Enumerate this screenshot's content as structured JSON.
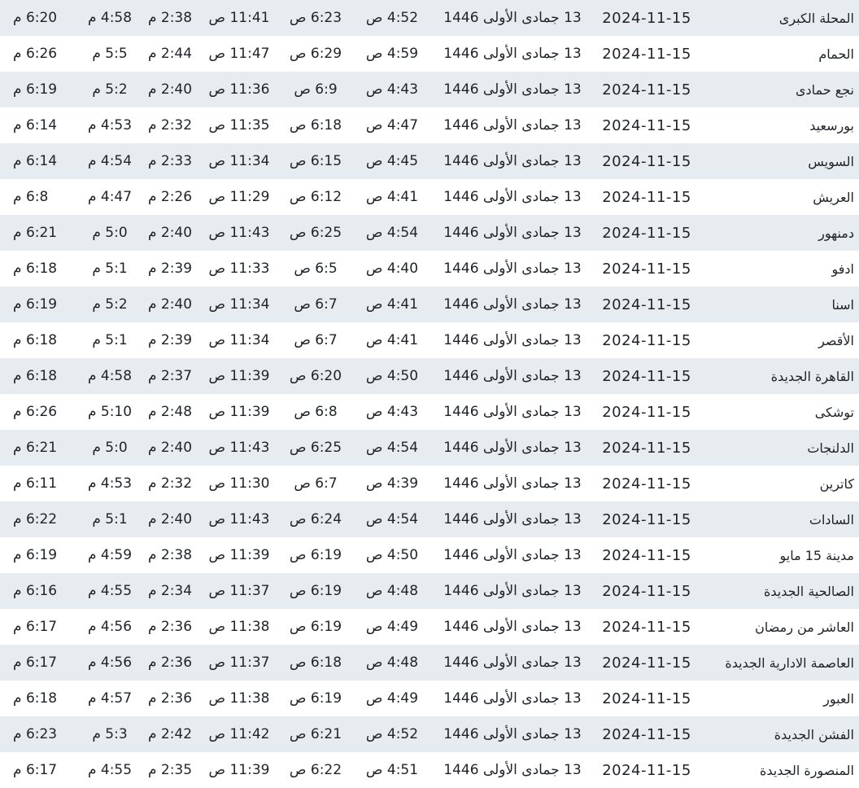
{
  "table": {
    "rows": [
      {
        "city": "المحلة الكبرى",
        "date": "2024-11-15",
        "hijri": "13 جمادى الأولى 1446",
        "fajr": "4:52 ص",
        "sunrise": "6:23 ص",
        "dhuhr": "11:41 ص",
        "asr": "2:38 م",
        "maghrib": "4:58 م",
        "isha": "6:20 م"
      },
      {
        "city": "الحمام",
        "date": "2024-11-15",
        "hijri": "13 جمادى الأولى 1446",
        "fajr": "4:59 ص",
        "sunrise": "6:29 ص",
        "dhuhr": "11:47 ص",
        "asr": "2:44 م",
        "maghrib": "5:5 م",
        "isha": "6:26 م"
      },
      {
        "city": "نجع حمادى",
        "date": "2024-11-15",
        "hijri": "13 جمادى الأولى 1446",
        "fajr": "4:43 ص",
        "sunrise": "6:9 ص",
        "dhuhr": "11:36 ص",
        "asr": "2:40 م",
        "maghrib": "5:2 م",
        "isha": "6:19 م"
      },
      {
        "city": "بورسعيد",
        "date": "2024-11-15",
        "hijri": "13 جمادى الأولى 1446",
        "fajr": "4:47 ص",
        "sunrise": "6:18 ص",
        "dhuhr": "11:35 ص",
        "asr": "2:32 م",
        "maghrib": "4:53 م",
        "isha": "6:14 م"
      },
      {
        "city": "السويس",
        "date": "2024-11-15",
        "hijri": "13 جمادى الأولى 1446",
        "fajr": "4:45 ص",
        "sunrise": "6:15 ص",
        "dhuhr": "11:34 ص",
        "asr": "2:33 م",
        "maghrib": "4:54 م",
        "isha": "6:14 م"
      },
      {
        "city": "العريش",
        "date": "2024-11-15",
        "hijri": "13 جمادى الأولى 1446",
        "fajr": "4:41 ص",
        "sunrise": "6:12 ص",
        "dhuhr": "11:29 ص",
        "asr": "2:26 م",
        "maghrib": "4:47 م",
        "isha": "6:8 م"
      },
      {
        "city": "دمنهور",
        "date": "2024-11-15",
        "hijri": "13 جمادى الأولى 1446",
        "fajr": "4:54 ص",
        "sunrise": "6:25 ص",
        "dhuhr": "11:43 ص",
        "asr": "2:40 م",
        "maghrib": "5:0 م",
        "isha": "6:21 م"
      },
      {
        "city": "ادفو",
        "date": "2024-11-15",
        "hijri": "13 جمادى الأولى 1446",
        "fajr": "4:40 ص",
        "sunrise": "6:5 ص",
        "dhuhr": "11:33 ص",
        "asr": "2:39 م",
        "maghrib": "5:1 م",
        "isha": "6:18 م"
      },
      {
        "city": "اسنا",
        "date": "2024-11-15",
        "hijri": "13 جمادى الأولى 1446",
        "fajr": "4:41 ص",
        "sunrise": "6:7 ص",
        "dhuhr": "11:34 ص",
        "asr": "2:40 م",
        "maghrib": "5:2 م",
        "isha": "6:19 م"
      },
      {
        "city": "الأقصر",
        "date": "2024-11-15",
        "hijri": "13 جمادى الأولى 1446",
        "fajr": "4:41 ص",
        "sunrise": "6:7 ص",
        "dhuhr": "11:34 ص",
        "asr": "2:39 م",
        "maghrib": "5:1 م",
        "isha": "6:18 م"
      },
      {
        "city": "القاهرة الجديدة",
        "date": "2024-11-15",
        "hijri": "13 جمادى الأولى 1446",
        "fajr": "4:50 ص",
        "sunrise": "6:20 ص",
        "dhuhr": "11:39 ص",
        "asr": "2:37 م",
        "maghrib": "4:58 م",
        "isha": "6:18 م"
      },
      {
        "city": "توشكى",
        "date": "2024-11-15",
        "hijri": "13 جمادى الأولى 1446",
        "fajr": "4:43 ص",
        "sunrise": "6:8 ص",
        "dhuhr": "11:39 ص",
        "asr": "2:48 م",
        "maghrib": "5:10 م",
        "isha": "6:26 م"
      },
      {
        "city": "الدلنجات",
        "date": "2024-11-15",
        "hijri": "13 جمادى الأولى 1446",
        "fajr": "4:54 ص",
        "sunrise": "6:25 ص",
        "dhuhr": "11:43 ص",
        "asr": "2:40 م",
        "maghrib": "5:0 م",
        "isha": "6:21 م"
      },
      {
        "city": "كاترين",
        "date": "2024-11-15",
        "hijri": "13 جمادى الأولى 1446",
        "fajr": "4:39 ص",
        "sunrise": "6:7 ص",
        "dhuhr": "11:30 ص",
        "asr": "2:32 م",
        "maghrib": "4:53 م",
        "isha": "6:11 م"
      },
      {
        "city": "السادات",
        "date": "2024-11-15",
        "hijri": "13 جمادى الأولى 1446",
        "fajr": "4:54 ص",
        "sunrise": "6:24 ص",
        "dhuhr": "11:43 ص",
        "asr": "2:40 م",
        "maghrib": "5:1 م",
        "isha": "6:22 م"
      },
      {
        "city": "مدينة 15 مايو",
        "date": "2024-11-15",
        "hijri": "13 جمادى الأولى 1446",
        "fajr": "4:50 ص",
        "sunrise": "6:19 ص",
        "dhuhr": "11:39 ص",
        "asr": "2:38 م",
        "maghrib": "4:59 م",
        "isha": "6:19 م"
      },
      {
        "city": "الصالحية الجديدة",
        "date": "2024-11-15",
        "hijri": "13 جمادى الأولى 1446",
        "fajr": "4:48 ص",
        "sunrise": "6:19 ص",
        "dhuhr": "11:37 ص",
        "asr": "2:34 م",
        "maghrib": "4:55 م",
        "isha": "6:16 م"
      },
      {
        "city": "العاشر من رمضان",
        "date": "2024-11-15",
        "hijri": "13 جمادى الأولى 1446",
        "fajr": "4:49 ص",
        "sunrise": "6:19 ص",
        "dhuhr": "11:38 ص",
        "asr": "2:36 م",
        "maghrib": "4:56 م",
        "isha": "6:17 م"
      },
      {
        "city": "العاصمة الادارية الجديدة",
        "date": "2024-11-15",
        "hijri": "13 جمادى الأولى 1446",
        "fajr": "4:48 ص",
        "sunrise": "6:18 ص",
        "dhuhr": "11:37 ص",
        "asr": "2:36 م",
        "maghrib": "4:56 م",
        "isha": "6:17 م"
      },
      {
        "city": "العبور",
        "date": "2024-11-15",
        "hijri": "13 جمادى الأولى 1446",
        "fajr": "4:49 ص",
        "sunrise": "6:19 ص",
        "dhuhr": "11:38 ص",
        "asr": "2:36 م",
        "maghrib": "4:57 م",
        "isha": "6:18 م"
      },
      {
        "city": "الفشن الجديدة",
        "date": "2024-11-15",
        "hijri": "13 جمادى الأولى 1446",
        "fajr": "4:52 ص",
        "sunrise": "6:21 ص",
        "dhuhr": "11:42 ص",
        "asr": "2:42 م",
        "maghrib": "5:3 م",
        "isha": "6:23 م"
      },
      {
        "city": "المنصورة الجديدة",
        "date": "2024-11-15",
        "hijri": "13 جمادى الأولى 1446",
        "fajr": "4:51 ص",
        "sunrise": "6:22 ص",
        "dhuhr": "11:39 ص",
        "asr": "2:35 م",
        "maghrib": "4:55 م",
        "isha": "6:17 م"
      }
    ]
  }
}
